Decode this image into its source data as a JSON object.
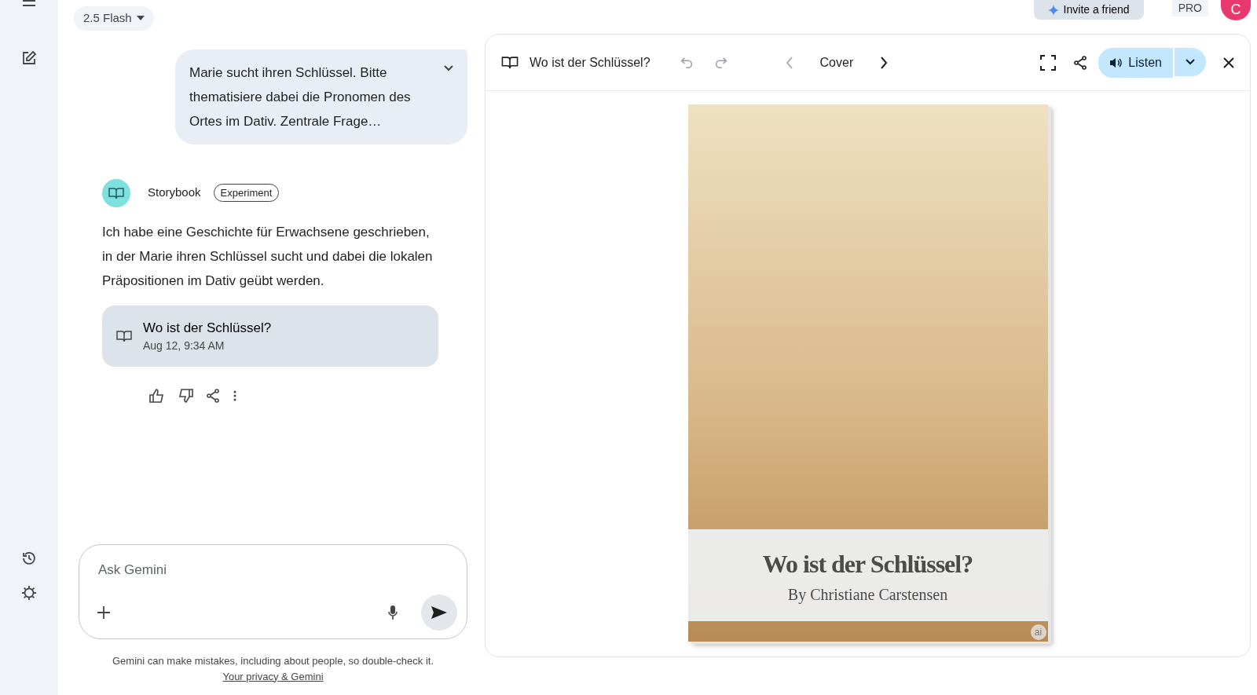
{
  "top_bar": {
    "model": "2.5 Flash",
    "invite": "Invite a friend",
    "plan": "PRO",
    "avatar": "C"
  },
  "prompt": {
    "text": "Marie sucht ihren Schlüssel. Bitte thematisiere dabei die Pronomen des Ortes im Dativ. Zentrale Frage…",
    "expanded": false
  },
  "response": {
    "sender": "Storybook",
    "tag": "Experiment",
    "text": "Ich habe eine Geschichte für Erwachsene geschrieben, in der Marie ihren Schlüssel sucht und dabei die lokalen Präpositionen im Dativ geübt werden.",
    "story": {
      "title": "Wo ist der Schlüssel?",
      "date": "Aug 12, 9:34 AM"
    }
  },
  "composer": {
    "placeholder": "Ask Gemini"
  },
  "disclaimer": "Gemini can make mistakes, including about people, so double-check it.",
  "privacy_link": "Your privacy & Gemini",
  "reader": {
    "title": "Wo ist der Schlüssel?",
    "history": [
      {
        "kind": "undo",
        "disabled": true
      },
      {
        "kind": "redo",
        "disabled": true
      }
    ],
    "page": {
      "label": "Cover",
      "prev_disabled": true,
      "next_disabled": false
    },
    "listen": "Listen",
    "cover": {
      "title": "Wo ist der Schlüssel?",
      "author": "By Christiane Carstensen",
      "badge": "ai"
    }
  }
}
